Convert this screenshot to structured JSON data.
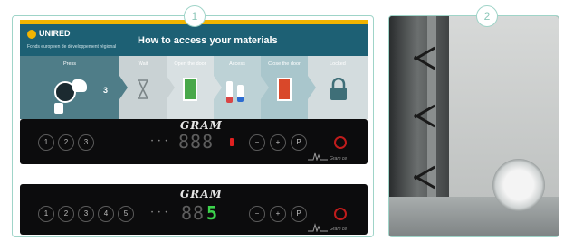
{
  "badges": [
    "1",
    "2"
  ],
  "poster": {
    "logo": "UNIRED",
    "logo_sub": "Fonds europeen de développement régional",
    "title": "How to access your materials",
    "steps": [
      {
        "label": "Press",
        "icon": "keypad-press-icon",
        "extra": "3"
      },
      {
        "label": "Wait",
        "icon": "hourglass-icon"
      },
      {
        "label": "Open the door",
        "icon": "open-door-icon"
      },
      {
        "label": "Access",
        "icon": "sample-vials-icon"
      },
      {
        "label": "Close the door",
        "icon": "closed-door-icon"
      },
      {
        "label": "Locked",
        "icon": "padlock-icon"
      }
    ]
  },
  "controller1": {
    "brand": "GRAM",
    "buttons": [
      "1",
      "2",
      "3"
    ],
    "indicator": "• • •",
    "display": "888",
    "controls": [
      "−",
      "+",
      "P"
    ],
    "label": "Gram ce"
  },
  "controller2": {
    "brand": "GRAM",
    "buttons": [
      "1",
      "2",
      "3",
      "4",
      "5"
    ],
    "indicator": "• • •",
    "display_dim": "88",
    "display_lit": "5",
    "controls": [
      "−",
      "+",
      "P"
    ],
    "label": "Gram ce"
  },
  "colors": {
    "badge_border": "#9fd4c8",
    "poster_header": "#1d6074",
    "accent_yellow": "#f2b400",
    "display_green": "#3cd34c",
    "led_red": "#e02020"
  }
}
